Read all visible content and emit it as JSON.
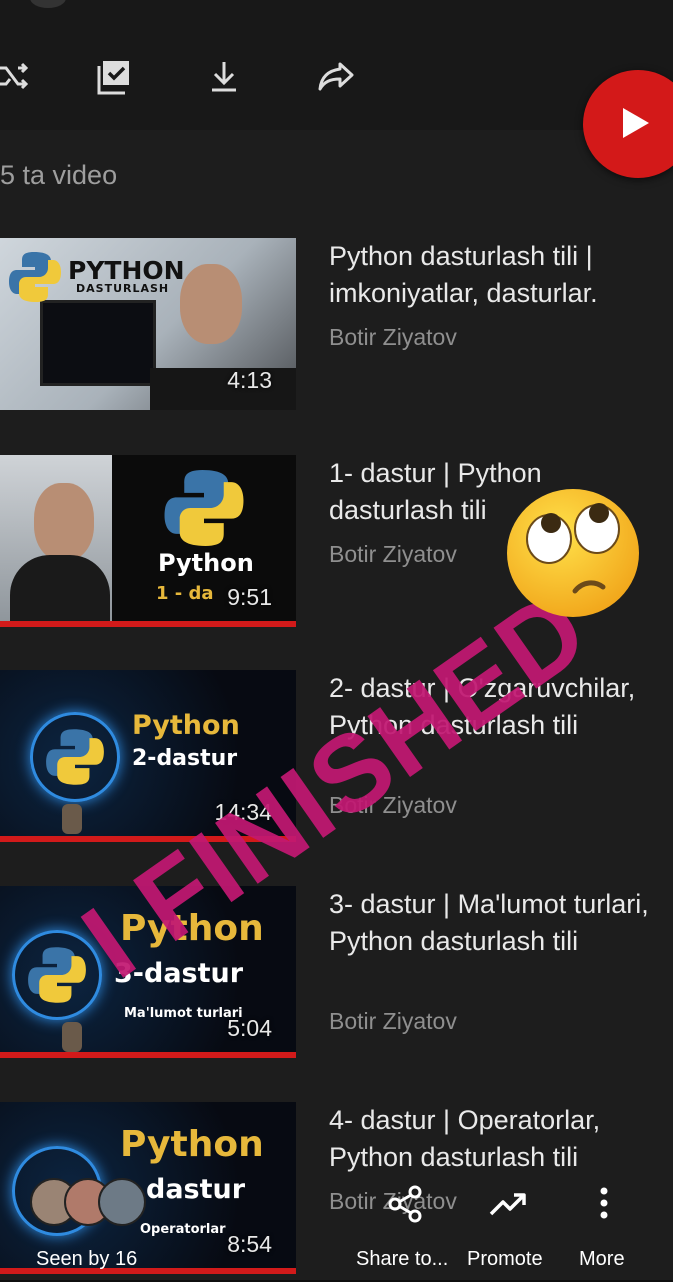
{
  "playlist": {
    "count_label": "5 ta video"
  },
  "videos": [
    {
      "title": "Python dasturlash tili | imkoniyatlar, dasturlar.",
      "channel": "Botir Ziyatov",
      "duration": "4:13",
      "thumb_text_1": "PYTHON",
      "thumb_text_2": "DASTURLASH"
    },
    {
      "title": "1- dastur | Python dasturlash tili",
      "channel": "Botir Ziyatov",
      "duration": "9:51",
      "thumb_text_1": "Python",
      "thumb_text_2": "1 - da"
    },
    {
      "title": "2- dastur | O'zgaruvchilar, Python dasturlash tili",
      "channel": "Botir Ziyatov",
      "duration": "14:34",
      "thumb_text_1": "Python",
      "thumb_text_2": "2-dastur"
    },
    {
      "title": "3- dastur | Ma'lumot turlari, Python dasturlash tili",
      "channel": "Botir Ziyatov",
      "duration": "5:04",
      "thumb_text_1": "Python",
      "thumb_text_2": "3-dastur",
      "thumb_text_3": "Ma'lumot turlari"
    },
    {
      "title": "4- dastur | Operatorlar, Python dasturlash tili",
      "channel": "Botir Ziyatov",
      "duration": "8:54",
      "thumb_text_1": "Python",
      "thumb_text_2": "dastur",
      "thumb_text_3": "Operatorlar"
    }
  ],
  "overlay": {
    "text": "I FINISHED",
    "emoji": "face-with-rolling-eyes"
  },
  "story": {
    "seen_label": "Seen by 16",
    "share_label": "Share to...",
    "promote_label": "Promote",
    "more_label": "More"
  },
  "colors": {
    "accent_red": "#d21a1a",
    "overlay_pink": "#c21872"
  }
}
